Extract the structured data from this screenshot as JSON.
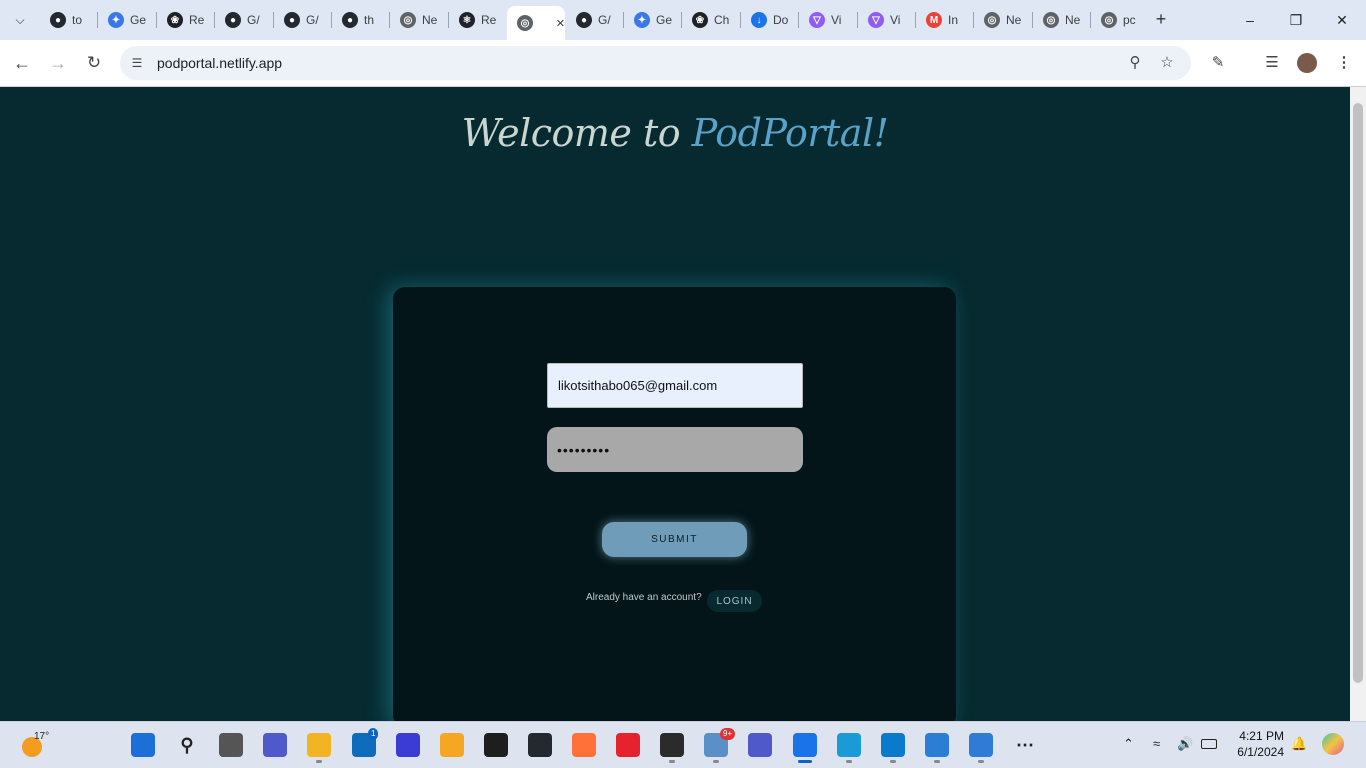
{
  "browser": {
    "tabs": [
      {
        "icon": "github-icon",
        "label": "to",
        "color": "#24292f"
      },
      {
        "icon": "gemini-icon",
        "label": "Ge",
        "color": "#3b78e7"
      },
      {
        "icon": "openai-icon",
        "label": "Re",
        "color": "#202124"
      },
      {
        "icon": "github-icon",
        "label": "G/",
        "color": "#24292f"
      },
      {
        "icon": "github-icon",
        "label": "G/",
        "color": "#24292f"
      },
      {
        "icon": "github-icon",
        "label": "th",
        "color": "#24292f"
      },
      {
        "icon": "globe-icon",
        "label": "Ne",
        "color": "#5f6368"
      },
      {
        "icon": "react-icon",
        "label": "Re",
        "color": "#20232a"
      },
      {
        "icon": "globe-icon",
        "label": "",
        "color": "#5f6368",
        "active": true
      },
      {
        "icon": "github-icon",
        "label": "G/",
        "color": "#24292f"
      },
      {
        "icon": "gemini-icon",
        "label": "Ge",
        "color": "#3b78e7"
      },
      {
        "icon": "openai-icon",
        "label": "Ch",
        "color": "#202124"
      },
      {
        "icon": "download-icon",
        "label": "Do",
        "color": "#1a73e8"
      },
      {
        "icon": "vite-icon",
        "label": "Vi",
        "color": "#8f5cf6"
      },
      {
        "icon": "vite-icon",
        "label": "Vi",
        "color": "#8f5cf6"
      },
      {
        "icon": "gmail-icon",
        "label": "In",
        "color": "#ea4335"
      },
      {
        "icon": "globe-icon",
        "label": "Ne",
        "color": "#5f6368"
      },
      {
        "icon": "globe-icon",
        "label": "Ne",
        "color": "#5f6368"
      },
      {
        "icon": "globe-icon",
        "label": "pc",
        "color": "#5f6368"
      }
    ],
    "url": "podportal.netlify.app"
  },
  "page": {
    "heading_prefix": "Welcome to ",
    "heading_brand": "PodPortal!",
    "email_value": "likotsithabo065@gmail.com",
    "password_value": "•••••••••",
    "submit_label": "SUBMIT",
    "already_text": "Already have an account?",
    "login_label": "LOGIN"
  },
  "taskbar": {
    "temperature": "17°",
    "apps": [
      {
        "name": "start-icon",
        "color": "#1b6fd6"
      },
      {
        "name": "search-icon",
        "color": "#333"
      },
      {
        "name": "task-view-icon",
        "color": "#555"
      },
      {
        "name": "teams-icon",
        "color": "#5059c9"
      },
      {
        "name": "file-explorer-icon",
        "color": "#f2b422"
      },
      {
        "name": "store-icon",
        "color": "#0f6cbd",
        "badge": "1"
      },
      {
        "name": "app-icon",
        "color": "#3b3bd6"
      },
      {
        "name": "app-icon",
        "color": "#f5a623"
      },
      {
        "name": "figma-icon",
        "color": "#1e1e1e"
      },
      {
        "name": "github-desktop-icon",
        "color": "#24292f"
      },
      {
        "name": "firefox-icon",
        "color": "#ff7139"
      },
      {
        "name": "opera-icon",
        "color": "#e5222d"
      },
      {
        "name": "app-icon",
        "color": "#2b2b2b"
      },
      {
        "name": "settings-app-icon",
        "color": "#5a8fc8",
        "badge": "9+"
      },
      {
        "name": "teams-new-icon",
        "color": "#5059c9"
      },
      {
        "name": "chrome-icon",
        "color": "#1a73e8"
      },
      {
        "name": "edge-icon",
        "color": "#1a9ad6"
      },
      {
        "name": "vscode-icon",
        "color": "#0a7acc"
      },
      {
        "name": "notepad-icon",
        "color": "#2a7fd4"
      },
      {
        "name": "photos-icon",
        "color": "#2f7bd6"
      },
      {
        "name": "more-apps-icon",
        "color": "#333"
      }
    ],
    "time": "4:21 PM",
    "date": "6/1/2024"
  }
}
